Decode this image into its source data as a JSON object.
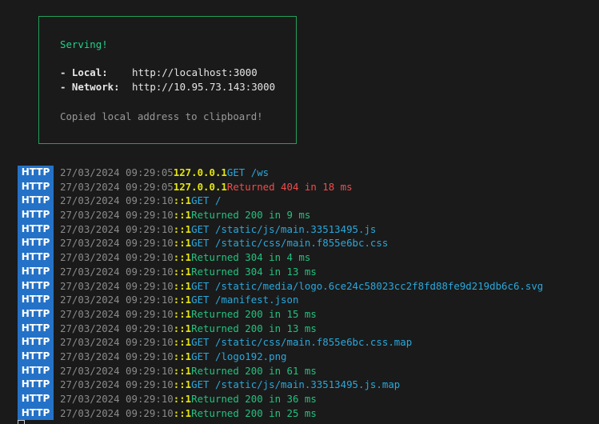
{
  "serve_box": {
    "title": "Serving!",
    "local_label": "- Local:",
    "local_url": "http://localhost:3000",
    "network_label": "- Network:",
    "network_url": "http://10.95.73.143:3000",
    "copied_message": "Copied local address to clipboard!"
  },
  "log": [
    {
      "badge": "HTTP",
      "timestamp": "27/03/2024 09:29:05",
      "ip": "127.0.0.1",
      "type": "get",
      "message": "GET /ws"
    },
    {
      "badge": "HTTP",
      "timestamp": "27/03/2024 09:29:05",
      "ip": "127.0.0.1",
      "type": "err",
      "message": "Returned 404 in 18 ms"
    },
    {
      "badge": "HTTP",
      "timestamp": "27/03/2024 09:29:10",
      "ip": "::1",
      "type": "get",
      "message": "GET /"
    },
    {
      "badge": "HTTP",
      "timestamp": "27/03/2024 09:29:10",
      "ip": "::1",
      "type": "ok",
      "message": "Returned 200 in 9 ms"
    },
    {
      "badge": "HTTP",
      "timestamp": "27/03/2024 09:29:10",
      "ip": "::1",
      "type": "get",
      "message": "GET /static/js/main.33513495.js"
    },
    {
      "badge": "HTTP",
      "timestamp": "27/03/2024 09:29:10",
      "ip": "::1",
      "type": "get",
      "message": "GET /static/css/main.f855e6bc.css"
    },
    {
      "badge": "HTTP",
      "timestamp": "27/03/2024 09:29:10",
      "ip": "::1",
      "type": "ok",
      "message": "Returned 304 in 4 ms"
    },
    {
      "badge": "HTTP",
      "timestamp": "27/03/2024 09:29:10",
      "ip": "::1",
      "type": "ok",
      "message": "Returned 304 in 13 ms"
    },
    {
      "badge": "HTTP",
      "timestamp": "27/03/2024 09:29:10",
      "ip": "::1",
      "type": "get",
      "message": "GET /static/media/logo.6ce24c58023cc2f8fd88fe9d219db6c6.svg"
    },
    {
      "badge": "HTTP",
      "timestamp": "27/03/2024 09:29:10",
      "ip": "::1",
      "type": "get",
      "message": "GET /manifest.json"
    },
    {
      "badge": "HTTP",
      "timestamp": "27/03/2024 09:29:10",
      "ip": "::1",
      "type": "ok",
      "message": "Returned 200 in 15 ms"
    },
    {
      "badge": "HTTP",
      "timestamp": "27/03/2024 09:29:10",
      "ip": "::1",
      "type": "ok",
      "message": "Returned 200 in 13 ms"
    },
    {
      "badge": "HTTP",
      "timestamp": "27/03/2024 09:29:10",
      "ip": "::1",
      "type": "get",
      "message": "GET /static/css/main.f855e6bc.css.map"
    },
    {
      "badge": "HTTP",
      "timestamp": "27/03/2024 09:29:10",
      "ip": "::1",
      "type": "get",
      "message": "GET /logo192.png"
    },
    {
      "badge": "HTTP",
      "timestamp": "27/03/2024 09:29:10",
      "ip": "::1",
      "type": "ok",
      "message": "Returned 200 in 61 ms"
    },
    {
      "badge": "HTTP",
      "timestamp": "27/03/2024 09:29:10",
      "ip": "::1",
      "type": "get",
      "message": "GET /static/js/main.33513495.js.map"
    },
    {
      "badge": "HTTP",
      "timestamp": "27/03/2024 09:29:10",
      "ip": "::1",
      "type": "ok",
      "message": "Returned 200 in 36 ms"
    },
    {
      "badge": "HTTP",
      "timestamp": "27/03/2024 09:29:10",
      "ip": "::1",
      "type": "ok",
      "message": "Returned 200 in 25 ms"
    }
  ]
}
